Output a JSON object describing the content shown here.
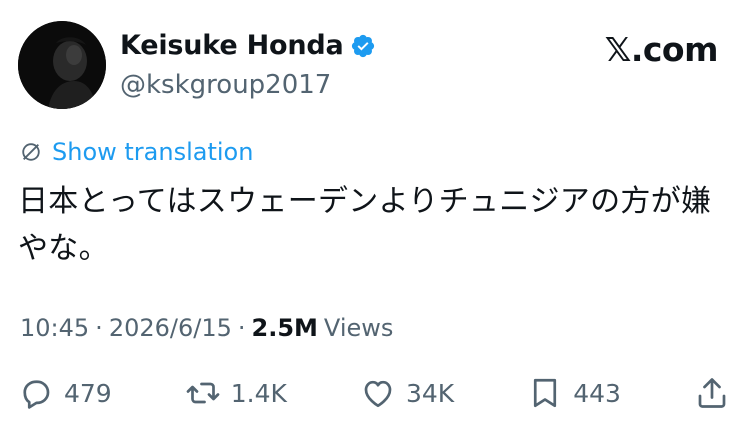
{
  "author": {
    "display_name": "Keisuke Honda",
    "handle": "@kskgroup2017",
    "verified": true
  },
  "brand": "𝕏.com",
  "translation_link": "Show translation",
  "tweet": {
    "text": "日本とってはスウェーデンよりチュニジアの方が嫌やな。"
  },
  "meta": {
    "time": "10:45",
    "separator": "·",
    "date": "2026/6/15",
    "views_count": "2.5M",
    "views_label": "Views"
  },
  "actions": {
    "replies": "479",
    "reposts": "1.4K",
    "likes": "34K",
    "bookmarks": "443"
  },
  "colors": {
    "accent": "#1d9bf0",
    "secondary_text": "#536471",
    "primary_text": "#0f1419"
  },
  "icons": {
    "verified": "verified-badge-icon",
    "translate": "globe-icon",
    "reply": "reply-icon",
    "repost": "repost-icon",
    "like": "heart-icon",
    "bookmark": "bookmark-icon",
    "share": "share-icon"
  }
}
